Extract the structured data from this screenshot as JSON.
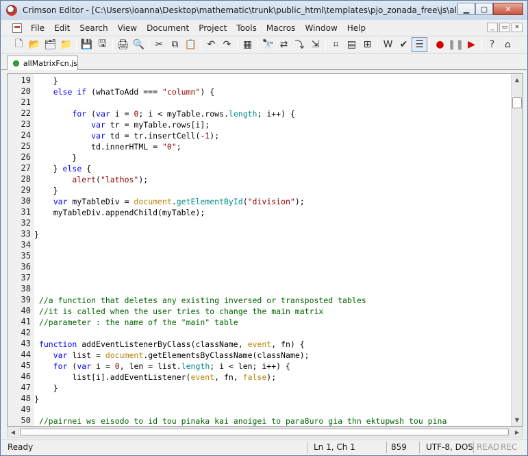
{
  "window": {
    "title": "Crimson Editor - [C:\\Users\\ioanna\\Desktop\\mathematic\\trunk\\public_html\\templates\\pjo_zonada_free\\js\\allMatrixFc...",
    "minimize": "0",
    "maximize": "1",
    "close": "✕"
  },
  "menu": {
    "items": [
      "File",
      "Edit",
      "Search",
      "View",
      "Document",
      "Project",
      "Tools",
      "Macros",
      "Window",
      "Help"
    ],
    "mdi_buttons": [
      "_",
      "▭",
      "✕"
    ]
  },
  "toolbar": {
    "buttons": [
      {
        "icon": "new-file-icon",
        "glyph": "🗋"
      },
      {
        "icon": "open-folder-icon",
        "glyph": "📂"
      },
      {
        "icon": "open-project-icon",
        "glyph": "🗂"
      },
      {
        "icon": "open-remote-icon",
        "glyph": "📁"
      },
      {
        "sep": true
      },
      {
        "icon": "save-icon",
        "glyph": "💾"
      },
      {
        "icon": "save-all-icon",
        "glyph": "🖫"
      },
      {
        "sep": true
      },
      {
        "icon": "print-icon",
        "glyph": "🖨"
      },
      {
        "icon": "print-preview-icon",
        "glyph": "🔍"
      },
      {
        "sep": true
      },
      {
        "icon": "cut-icon",
        "glyph": "✂"
      },
      {
        "icon": "copy-icon",
        "glyph": "⧉"
      },
      {
        "icon": "paste-icon",
        "glyph": "📋"
      },
      {
        "sep": true
      },
      {
        "icon": "undo-icon",
        "glyph": "↶"
      },
      {
        "icon": "redo-icon",
        "glyph": "↷"
      },
      {
        "sep": true
      },
      {
        "icon": "select-all-icon",
        "glyph": "▦"
      },
      {
        "sep": true
      },
      {
        "icon": "find-icon",
        "glyph": "🔭"
      },
      {
        "icon": "replace-icon",
        "glyph": "⇄"
      },
      {
        "icon": "find-next-icon",
        "glyph": "⤵"
      },
      {
        "icon": "goto-icon",
        "glyph": "⇲"
      },
      {
        "sep": true
      },
      {
        "icon": "word-wrap-icon",
        "glyph": "⌗"
      },
      {
        "icon": "toggle-panel-icon",
        "glyph": "▤"
      },
      {
        "icon": "directory-tree-icon",
        "glyph": "⊞"
      },
      {
        "sep": true
      },
      {
        "icon": "word-wrap-w-icon",
        "glyph": "W"
      },
      {
        "icon": "spell-check-icon",
        "glyph": "✔"
      },
      {
        "icon": "line-numbers-icon",
        "glyph": "☰",
        "active": true
      },
      {
        "sep": true
      },
      {
        "icon": "record-macro-icon",
        "glyph": "●",
        "color": "#d40000"
      },
      {
        "icon": "pause-macro-icon",
        "glyph": "❚❚",
        "color": "#999999"
      },
      {
        "icon": "play-macro-icon",
        "glyph": "▶",
        "color": "#d40000"
      },
      {
        "sep": true
      },
      {
        "icon": "help-icon",
        "glyph": "?"
      },
      {
        "icon": "home-icon",
        "glyph": "⌂"
      }
    ]
  },
  "tabs": [
    {
      "label": "allMatrixFcn.js"
    }
  ],
  "editor": {
    "lines": [
      {
        "n": "19",
        "tokens": [
          [
            "plain",
            "    }"
          ]
        ]
      },
      {
        "n": "20",
        "tokens": [
          [
            "plain",
            "    "
          ],
          [
            "kw",
            "else if"
          ],
          [
            "plain",
            " (whatToAdd === "
          ],
          [
            "str",
            "\"column\""
          ],
          [
            "plain",
            ") {"
          ]
        ]
      },
      {
        "n": "21",
        "tokens": []
      },
      {
        "n": "22",
        "tokens": [
          [
            "plain",
            "        "
          ],
          [
            "kw",
            "for"
          ],
          [
            "plain",
            " ("
          ],
          [
            "kw",
            "var"
          ],
          [
            "plain",
            " i = "
          ],
          [
            "num",
            "0"
          ],
          [
            "plain",
            "; i < myTable.rows."
          ],
          [
            "prop",
            "length"
          ],
          [
            "plain",
            "; i++) {"
          ]
        ]
      },
      {
        "n": "23",
        "tokens": [
          [
            "plain",
            "            "
          ],
          [
            "kw",
            "var"
          ],
          [
            "plain",
            " tr = myTable.rows[i];"
          ]
        ]
      },
      {
        "n": "24",
        "tokens": [
          [
            "plain",
            "            "
          ],
          [
            "kw",
            "var"
          ],
          [
            "plain",
            " td = tr.insertCell(-"
          ],
          [
            "num",
            "1"
          ],
          [
            "plain",
            ");"
          ]
        ]
      },
      {
        "n": "25",
        "tokens": [
          [
            "plain",
            "            td.innerHTML = "
          ],
          [
            "str",
            "\"0\""
          ],
          [
            "plain",
            ";"
          ]
        ]
      },
      {
        "n": "26",
        "tokens": [
          [
            "plain",
            "        }"
          ]
        ]
      },
      {
        "n": "27",
        "tokens": [
          [
            "plain",
            "    } "
          ],
          [
            "kw",
            "else"
          ],
          [
            "plain",
            " {"
          ]
        ]
      },
      {
        "n": "28",
        "tokens": [
          [
            "plain",
            "        "
          ],
          [
            "fn",
            "alert"
          ],
          [
            "plain",
            "("
          ],
          [
            "str",
            "\"lathos\""
          ],
          [
            "plain",
            ");"
          ]
        ]
      },
      {
        "n": "29",
        "tokens": [
          [
            "plain",
            "    }"
          ]
        ]
      },
      {
        "n": "30",
        "tokens": [
          [
            "plain",
            "    "
          ],
          [
            "kw",
            "var"
          ],
          [
            "plain",
            " myTableDiv = "
          ],
          [
            "builtin",
            "document"
          ],
          [
            "plain",
            "."
          ],
          [
            "prop",
            "getElementById"
          ],
          [
            "plain",
            "("
          ],
          [
            "str",
            "\"division\""
          ],
          [
            "plain",
            ");"
          ]
        ]
      },
      {
        "n": "31",
        "tokens": [
          [
            "plain",
            "    myTableDiv.appendChild(myTable);"
          ]
        ]
      },
      {
        "n": "32",
        "tokens": []
      },
      {
        "n": "33",
        "tokens": [
          [
            "plain",
            "}"
          ]
        ]
      },
      {
        "n": "34",
        "tokens": []
      },
      {
        "n": "35",
        "tokens": []
      },
      {
        "n": "36",
        "tokens": []
      },
      {
        "n": "37",
        "tokens": []
      },
      {
        "n": "38",
        "tokens": []
      },
      {
        "n": "39",
        "tokens": [
          [
            "plain",
            " "
          ],
          [
            "cm",
            "//a function that deletes any existing inversed or transposted tables"
          ]
        ]
      },
      {
        "n": "40",
        "tokens": [
          [
            "plain",
            " "
          ],
          [
            "cm",
            "//it is called when the user tries to change the main matrix"
          ]
        ]
      },
      {
        "n": "41",
        "tokens": [
          [
            "plain",
            " "
          ],
          [
            "cm",
            "//parameter : the name of the \"main\" table"
          ]
        ]
      },
      {
        "n": "42",
        "tokens": []
      },
      {
        "n": "43",
        "tokens": [
          [
            "plain",
            " "
          ],
          [
            "kw",
            "function"
          ],
          [
            "plain",
            " addEventListenerByClass(className, "
          ],
          [
            "builtin",
            "event"
          ],
          [
            "plain",
            ", fn) {"
          ]
        ]
      },
      {
        "n": "44",
        "tokens": [
          [
            "plain",
            "    "
          ],
          [
            "kw",
            "var"
          ],
          [
            "plain",
            " list = "
          ],
          [
            "builtin",
            "document"
          ],
          [
            "plain",
            ".getElementsByClassName(className);"
          ]
        ]
      },
      {
        "n": "45",
        "tokens": [
          [
            "plain",
            "    "
          ],
          [
            "kw",
            "for"
          ],
          [
            "plain",
            " ("
          ],
          [
            "kw",
            "var"
          ],
          [
            "plain",
            " i = "
          ],
          [
            "num",
            "0"
          ],
          [
            "plain",
            ", len = list."
          ],
          [
            "prop",
            "length"
          ],
          [
            "plain",
            "; i < len; i++) {"
          ]
        ]
      },
      {
        "n": "46",
        "tokens": [
          [
            "plain",
            "        list[i].addEventListener("
          ],
          [
            "builtin",
            "event"
          ],
          [
            "plain",
            ", fn, "
          ],
          [
            "builtin",
            "false"
          ],
          [
            "plain",
            ");"
          ]
        ]
      },
      {
        "n": "47",
        "tokens": [
          [
            "plain",
            "    }"
          ]
        ]
      },
      {
        "n": "48",
        "tokens": [
          [
            "plain",
            "}"
          ]
        ]
      },
      {
        "n": "49",
        "tokens": []
      },
      {
        "n": "50",
        "tokens": [
          [
            "plain",
            " "
          ],
          [
            "cm",
            "//pairnei ws eisodo to id tou pinaka kai anoigei to para8uro gia thn ektupwsh tou pina"
          ]
        ]
      }
    ]
  },
  "scroll": {
    "up": "▲",
    "down": "▼",
    "left": "◀",
    "right": "▶"
  },
  "status": {
    "ready": "Ready",
    "position": "Ln 1, Ch 1",
    "length": "859",
    "encoding": "UTF-8, DOS",
    "read": "READ",
    "rec": "REC"
  }
}
